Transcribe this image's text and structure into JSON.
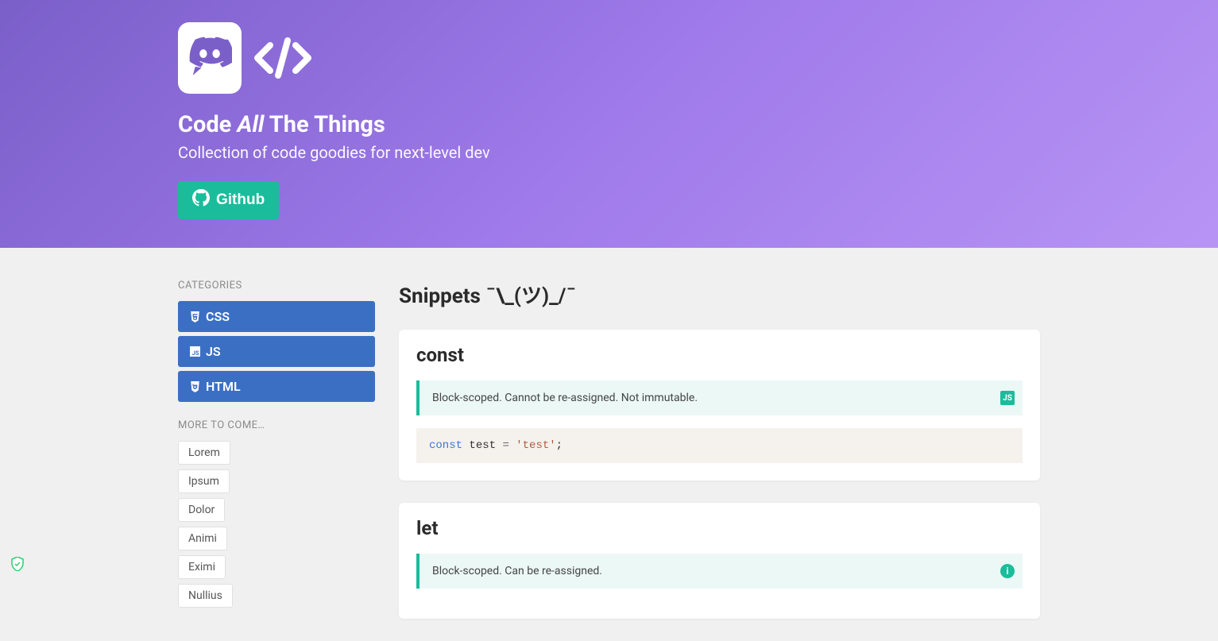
{
  "hero": {
    "title_pre": "Code ",
    "title_italic": "All",
    "title_post": " The Things",
    "subtitle": "Collection of code goodies for next-level dev",
    "github_label": "Github"
  },
  "sidebar": {
    "categories_label": "CATEGORIES",
    "categories": [
      {
        "icon": "css3",
        "label": "CSS"
      },
      {
        "icon": "js",
        "label": "JS"
      },
      {
        "icon": "html5",
        "label": "HTML"
      }
    ],
    "more_label": "MORE TO COME…",
    "tags": [
      "Lorem",
      "Ipsum",
      "Dolor",
      "Animi",
      "Eximi",
      "Nullius"
    ]
  },
  "main": {
    "heading": "Snippets ¯\\_(ツ)_/¯",
    "snippets": [
      {
        "title": "const",
        "description": "Block-scoped. Cannot be re-assigned. Not immutable.",
        "badge": "JS",
        "badge_type": "js",
        "code": {
          "keyword": "const",
          "rest1": " test ",
          "op": "=",
          "rest2": " ",
          "string": "'test'",
          "end": ";"
        }
      },
      {
        "title": "let",
        "description": "Block-scoped. Can be re-assigned.",
        "badge": "i",
        "badge_type": "info"
      }
    ]
  }
}
